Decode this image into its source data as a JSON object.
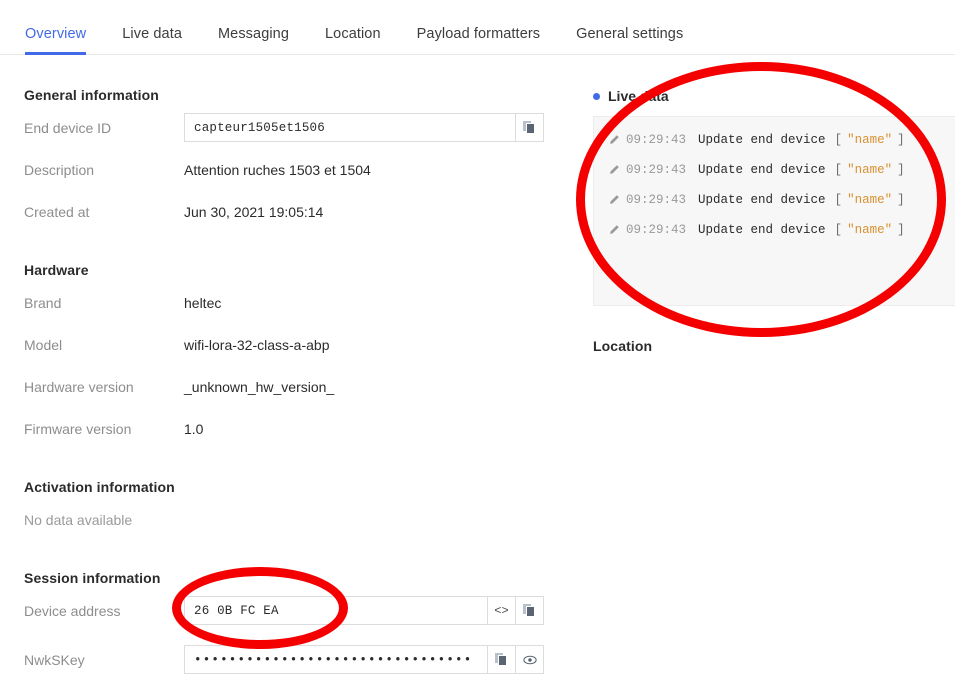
{
  "tabs": [
    {
      "label": "Overview",
      "active": true
    },
    {
      "label": "Live data",
      "active": false
    },
    {
      "label": "Messaging",
      "active": false
    },
    {
      "label": "Location",
      "active": false
    },
    {
      "label": "Payload formatters",
      "active": false
    },
    {
      "label": "General settings",
      "active": false
    }
  ],
  "general_information": {
    "heading": "General information",
    "end_device_id_label": "End device ID",
    "end_device_id_value": "capteur1505et1506",
    "description_label": "Description",
    "description_value": "Attention ruches 1503 et 1504",
    "created_at_label": "Created at",
    "created_at_value": "Jun 30, 2021 19:05:14"
  },
  "hardware": {
    "heading": "Hardware",
    "brand_label": "Brand",
    "brand_value": "heltec",
    "model_label": "Model",
    "model_value": "wifi-lora-32-class-a-abp",
    "hardware_version_label": "Hardware version",
    "hardware_version_value": "_unknown_hw_version_",
    "firmware_version_label": "Firmware version",
    "firmware_version_value": "1.0"
  },
  "activation_information": {
    "heading": "Activation information",
    "empty_text": "No data available"
  },
  "session_information": {
    "heading": "Session information",
    "device_address_label": "Device address",
    "device_address_value": "26 0B FC EA",
    "nwkskey_label": "NwkSKey",
    "nwkskey_value": "••••••••••••••••••••••••••••••••"
  },
  "live_data": {
    "title": "Live data",
    "entries": [
      {
        "time": "09:29:43",
        "message": "Update end device",
        "bracket_open": "[",
        "name": "\"name\"",
        "bracket_close": "]"
      },
      {
        "time": "09:29:43",
        "message": "Update end device",
        "bracket_open": "[",
        "name": "\"name\"",
        "bracket_close": "]"
      },
      {
        "time": "09:29:43",
        "message": "Update end device",
        "bracket_open": "[",
        "name": "\"name\"",
        "bracket_close": "]"
      },
      {
        "time": "09:29:43",
        "message": "Update end device",
        "bracket_open": "[",
        "name": "\"name\"",
        "bracket_close": "]"
      }
    ]
  },
  "location": {
    "heading": "Location"
  },
  "icons": {
    "copy": "copy-icon",
    "code": "<>",
    "eye": "eye-icon",
    "pencil": "pencil-icon"
  },
  "colors": {
    "accent_blue": "#4169e8",
    "annotation_red": "#f40000",
    "log_name_orange": "#d9912f",
    "label_gray": "#8d8d8d"
  }
}
